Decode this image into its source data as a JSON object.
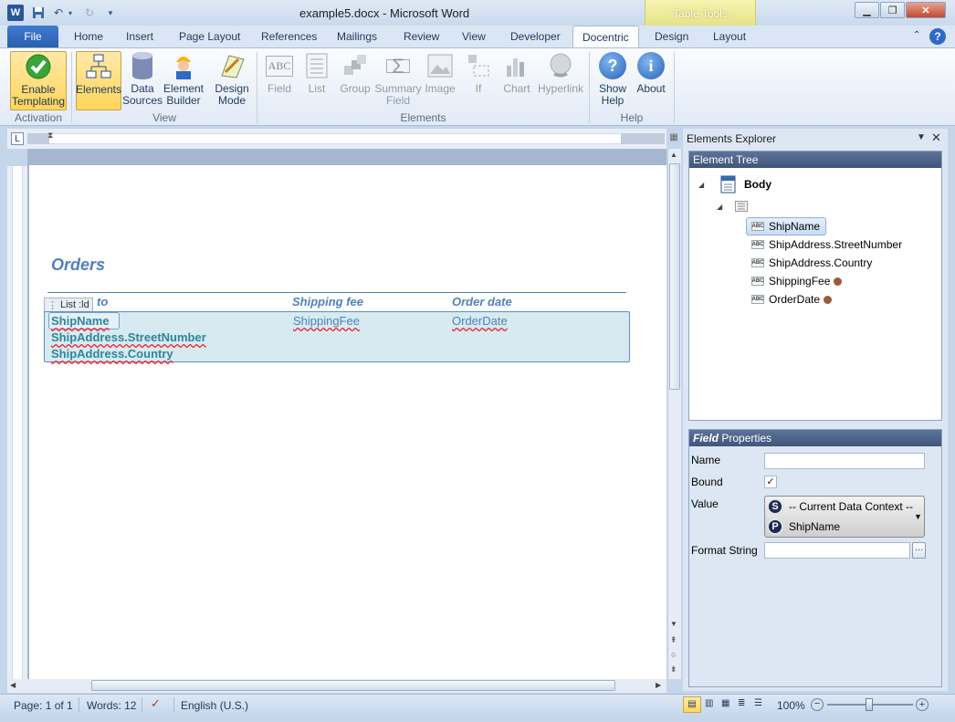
{
  "window": {
    "title": "example5.docx - Microsoft Word",
    "contextual_tab": "Table Tools"
  },
  "tabs": [
    {
      "label": "File"
    },
    {
      "label": "Home"
    },
    {
      "label": "Insert"
    },
    {
      "label": "Page Layout"
    },
    {
      "label": "References"
    },
    {
      "label": "Mailings"
    },
    {
      "label": "Review"
    },
    {
      "label": "View"
    },
    {
      "label": "Developer"
    },
    {
      "label": "Docentric"
    },
    {
      "label": "Design"
    },
    {
      "label": "Layout"
    }
  ],
  "ribbon": {
    "activation": {
      "label": "Activation",
      "enable_line1": "Enable",
      "enable_line2": "Templating"
    },
    "view": {
      "label": "View",
      "elements": "Elements",
      "data1": "Data",
      "data2": "Sources",
      "builder1": "Element",
      "builder2": "Builder",
      "design1": "Design",
      "design2": "Mode"
    },
    "elements": {
      "label": "Elements",
      "field": "Field",
      "list": "List",
      "group": "Group",
      "summary1": "Summary",
      "summary2": "Field",
      "image": "Image",
      "if": "If",
      "chart": "Chart",
      "hyperlink": "Hyperlink"
    },
    "help": {
      "label": "Help",
      "show1": "Show",
      "show2": "Help",
      "about": "About"
    }
  },
  "document": {
    "heading": "Orders",
    "list_tag": "List",
    "list_tag_suffix": ":ld",
    "col1_header": "to",
    "col2_header": "Shipping fee",
    "col3_header": "Order date",
    "row_name": "ShipName",
    "row_street": "ShipAddress.StreetNumber",
    "row_country": "ShipAddress.Country",
    "row_fee": "ShippingFee",
    "row_date": "OrderDate"
  },
  "explorer": {
    "title": "Elements Explorer",
    "tree_header": "Element Tree",
    "body": "Body",
    "items": [
      "ShipName",
      "ShipAddress.StreetNumber",
      "ShipAddress.Country",
      "ShippingFee",
      "OrderDate"
    ],
    "props_header_italic": "Field",
    "props_header": "Properties",
    "name_label": "Name",
    "bound_label": "Bound",
    "value_label": "Value",
    "value_line1": "-- Current Data Context --",
    "value_line2": "ShipName",
    "format_label": "Format String"
  },
  "status": {
    "page": "Page: 1 of 1",
    "words": "Words: 12",
    "language": "English (U.S.)",
    "zoom": "100%"
  }
}
